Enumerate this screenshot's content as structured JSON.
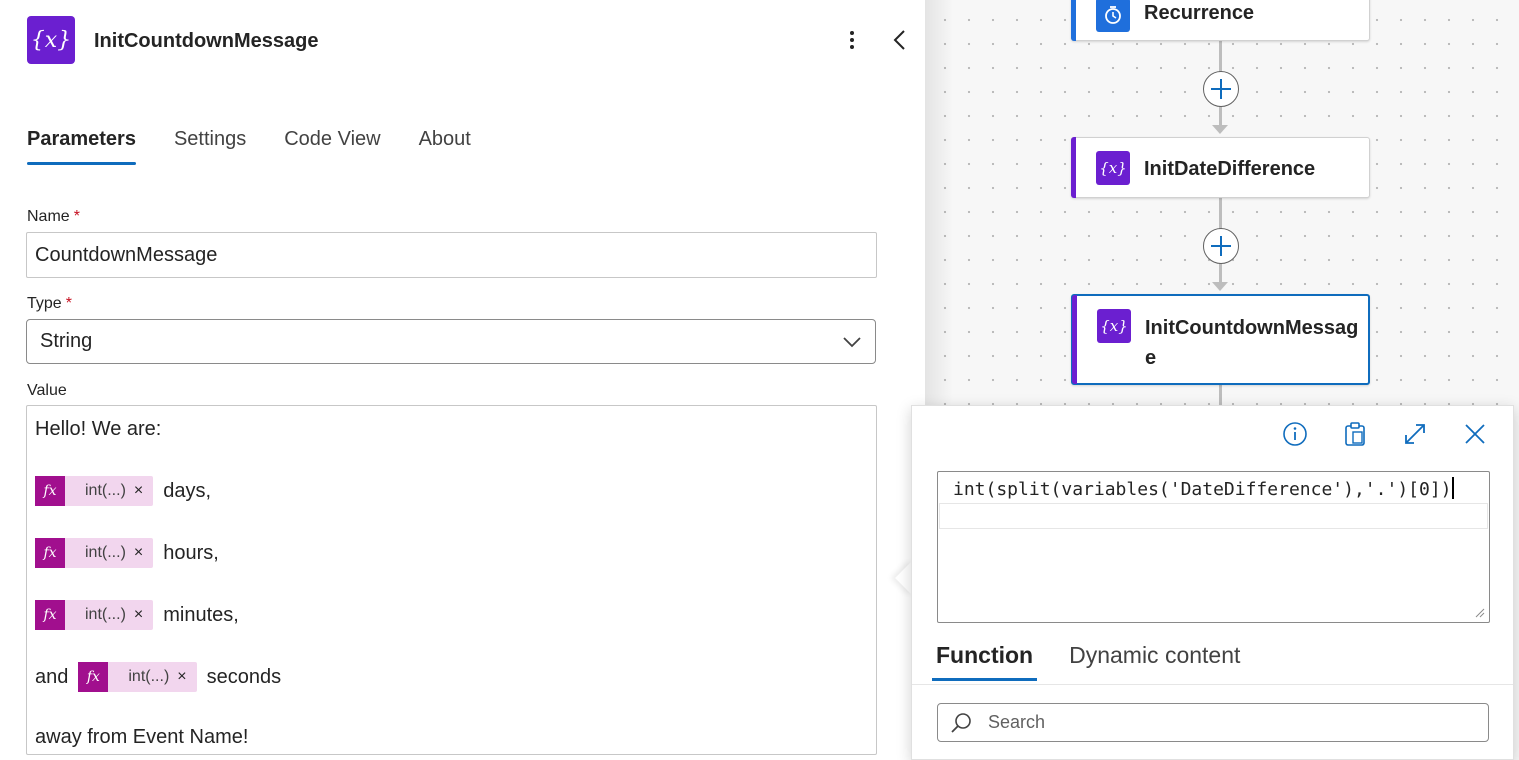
{
  "panel": {
    "title": "InitCountdownMessage",
    "icon": "variable-icon",
    "tabs": [
      {
        "label": "Parameters",
        "active": true
      },
      {
        "label": "Settings",
        "active": false
      },
      {
        "label": "Code View",
        "active": false
      },
      {
        "label": "About",
        "active": false
      }
    ],
    "name_label": "Name",
    "name_value": "CountdownMessage",
    "type_label": "Type",
    "type_value": "String",
    "value_label": "Value",
    "required_mark": "*",
    "value_lines": {
      "line1": "Hello! We are:",
      "days": "days,",
      "hours": "hours,",
      "minutes": "minutes,",
      "and": "and",
      "seconds": "seconds",
      "last": "away from Event Name!"
    },
    "token": {
      "fx_label": "fx",
      "text": "int(...)",
      "remove": "×"
    }
  },
  "canvas": {
    "nodes": [
      {
        "label": "Recurrence",
        "icon": "clock-icon",
        "color": "#1f6fdc"
      },
      {
        "label": "InitDateDifference",
        "icon": "variable-icon",
        "color": "#6b1fd0"
      },
      {
        "label": "InitCountdownMessage",
        "icon": "variable-icon",
        "color": "#6b1fd0",
        "selected": true
      }
    ],
    "node_icon_text": "{x}"
  },
  "popup": {
    "expression": "int(split(variables('DateDifference'),'.')[0])",
    "tabs": [
      {
        "label": "Function",
        "active": true
      },
      {
        "label": "Dynamic content",
        "active": false
      }
    ],
    "search_placeholder": "Search"
  },
  "colors": {
    "accent": "#0f6cbd",
    "variable_purple": "#6b1fd0",
    "token_magenta": "#a10f8e",
    "token_bg": "#f2d6ee",
    "required": "#c50f1f"
  }
}
